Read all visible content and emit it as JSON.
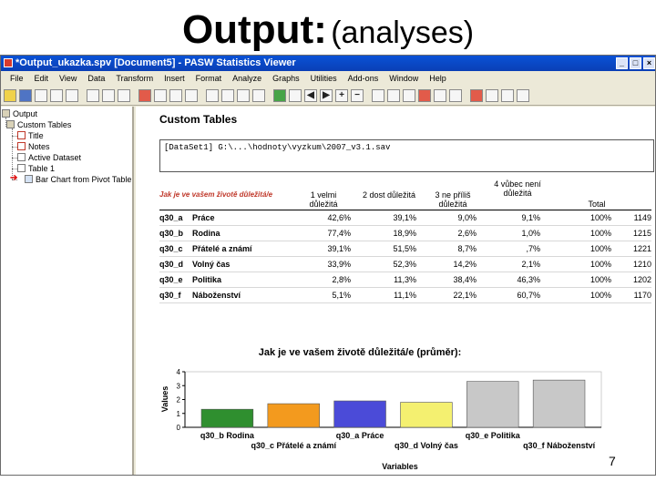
{
  "slide": {
    "title_main": "Output",
    "title_colon": ":",
    "title_sub": "(analyses)",
    "page_number": "7"
  },
  "window": {
    "title": "*Output_ukazka.spv [Document5] - PASW Statistics Viewer",
    "menu": [
      "File",
      "Edit",
      "View",
      "Data",
      "Transform",
      "Insert",
      "Format",
      "Analyze",
      "Graphs",
      "Utilities",
      "Add-ons",
      "Window",
      "Help"
    ]
  },
  "outline": {
    "root": "Output",
    "group": "Custom Tables",
    "items": [
      "Title",
      "Notes",
      "Active Dataset",
      "Table 1",
      "Bar Chart from Pivot Table"
    ]
  },
  "content": {
    "title": "Custom Tables",
    "dataset_text": "[DataSet1] G:\\...\\hodnoty\\vyzkum\\2007_v3.1.sav",
    "table": {
      "row_header": "Jak je ve vašem životě důležitá/e",
      "columns": [
        "1 velmi důležitá",
        "2 dost důležitá",
        "3 ne příliš důležitá",
        "4 vůbec není důležitá",
        "Total",
        ""
      ],
      "rows": [
        {
          "code": "q30_a",
          "label": "Práce",
          "values": [
            "42,6%",
            "39,1%",
            "9,0%",
            "9,1%",
            "100%",
            "1149"
          ]
        },
        {
          "code": "q30_b",
          "label": "Rodina",
          "values": [
            "77,4%",
            "18,9%",
            "2,6%",
            "1,0%",
            "100%",
            "1215"
          ]
        },
        {
          "code": "q30_c",
          "label": "Přátelé a známí",
          "values": [
            "39,1%",
            "51,5%",
            "8,7%",
            ",7%",
            "100%",
            "1221"
          ]
        },
        {
          "code": "q30_d",
          "label": "Volný čas",
          "values": [
            "33,9%",
            "52,3%",
            "14,2%",
            "2,1%",
            "100%",
            "1210"
          ]
        },
        {
          "code": "q30_e",
          "label": "Politika",
          "values": [
            "2,8%",
            "11,3%",
            "38,4%",
            "46,3%",
            "100%",
            "1202"
          ]
        },
        {
          "code": "q30_f",
          "label": "Náboženství",
          "values": [
            "5,1%",
            "11,1%",
            "22,1%",
            "60,7%",
            "100%",
            "1170"
          ]
        }
      ]
    }
  },
  "chart_data": {
    "type": "bar",
    "title": "Jak je ve vašem životě důležitá/e (průměr):",
    "xlabel": "Variables",
    "ylabel": "Values",
    "ylim": [
      0,
      4
    ],
    "yticks": [
      "0",
      "1",
      "2",
      "3",
      "4"
    ],
    "categories": [
      "q30_b Rodina",
      "q30_c Přátelé a známí",
      "q30_a Práce",
      "q30_d Volný čas",
      "q30_e Politika",
      "q30_f Náboženství"
    ],
    "values": [
      1.3,
      1.7,
      1.9,
      1.8,
      3.3,
      3.4
    ],
    "colors": [
      "#2f8f2f",
      "#f39a1e",
      "#4b4bd8",
      "#f4f070",
      "#c8c8c8",
      "#c8c8c8"
    ],
    "grid": false,
    "legend": "none"
  }
}
